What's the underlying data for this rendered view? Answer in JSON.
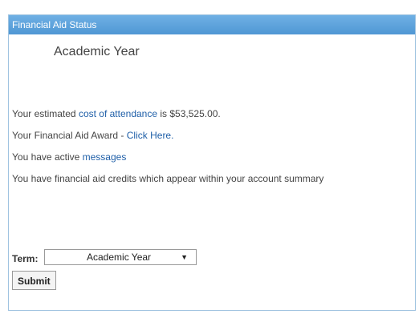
{
  "panel": {
    "title": "Financial Aid Status",
    "subtitle": "Academic Year"
  },
  "info": {
    "line1_prefix": "Your estimated ",
    "line1_link": "cost of attendance",
    "line1_suffix": " is $53,525.00.",
    "line2_prefix": "Your Financial Aid Award - ",
    "line2_link": "Click Here.",
    "line3_prefix": "You have active ",
    "line3_link": "messages",
    "line4": "You have financial aid credits which appear within your account summary"
  },
  "form": {
    "term_label": "Term:",
    "term_selected": "Academic Year",
    "dropdown_icon": "chevron-down-icon",
    "submit_label": "Submit"
  },
  "colors": {
    "header": "#5aa0da",
    "link": "#1f5fa8"
  }
}
